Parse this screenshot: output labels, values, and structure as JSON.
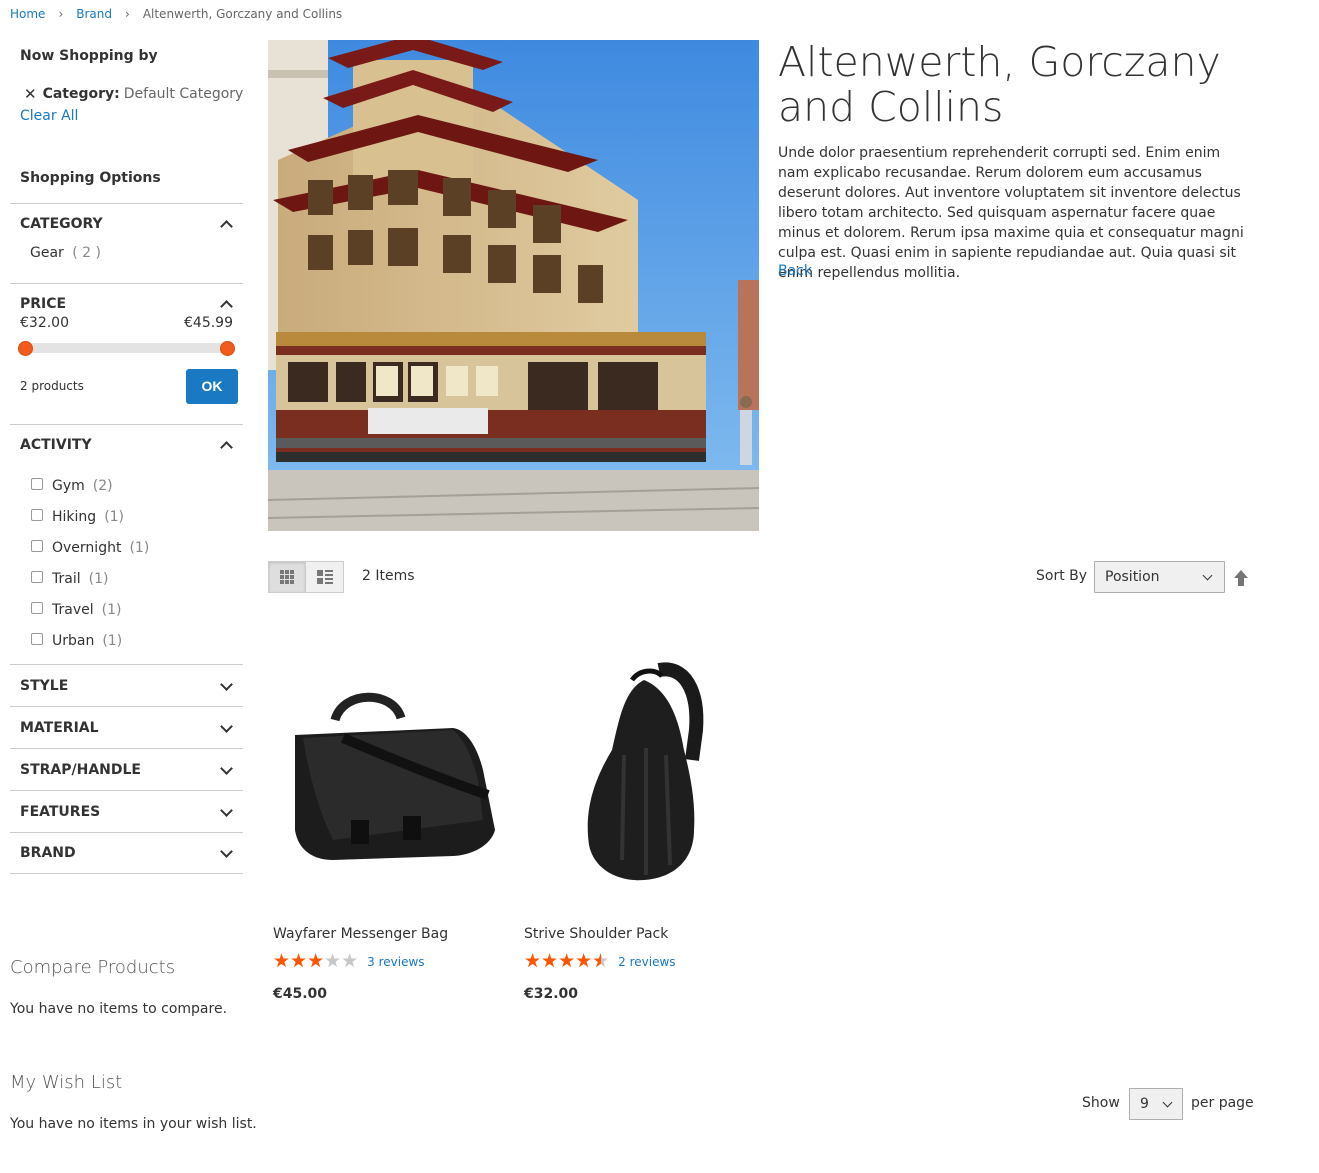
{
  "breadcrumb": {
    "home": "Home",
    "brand": "Brand",
    "current": "Altenwerth, Gorczany and Collins"
  },
  "sidebar": {
    "now_shopping_title": "Now Shopping by",
    "active_filter": {
      "label": "Category:",
      "value": "Default Category"
    },
    "clear_all": "Clear All",
    "shopping_options_title": "Shopping Options",
    "category": {
      "title": "Category",
      "items": [
        {
          "label": "Gear",
          "count": "( 2 )"
        }
      ]
    },
    "price": {
      "title": "Price",
      "min": "€32.00",
      "max": "€45.99",
      "range_low": 0,
      "range_high": 1,
      "product_count": "2 products",
      "ok": "OK"
    },
    "activity": {
      "title": "Activity",
      "items": [
        {
          "label": "Gym",
          "count": "(2)"
        },
        {
          "label": "Hiking",
          "count": "(1)"
        },
        {
          "label": "Overnight",
          "count": "(1)"
        },
        {
          "label": "Trail",
          "count": "(1)"
        },
        {
          "label": "Travel",
          "count": "(1)"
        },
        {
          "label": "Urban",
          "count": "(1)"
        }
      ]
    },
    "collapsed_sections": [
      "Style",
      "Material",
      "Strap/Handle",
      "Features",
      "Brand"
    ],
    "compare_title": "Compare Products",
    "compare_empty": "You have no items to compare.",
    "wishlist_title": "My Wish List",
    "wishlist_empty": "You have no items in your wish list."
  },
  "brand": {
    "title": "Altenwerth, Gorczany and Collins",
    "description": "Unde dolor praesentium reprehenderit corrupti sed. Enim enim nam explicabo recusandae. Rerum dolorem eum accusamus deserunt dolores. Aut inventore voluptatem sit inventore delectus libero totam architecto. Sed quisquam aspernatur facere quae minus et dolorem. Rerum ipsa maxime quia et consequatur magni culpa est. Quasi enim in sapiente repudiandae aut. Quia quasi sit enim repellendus mollitia.",
    "back": "Back"
  },
  "toolbar": {
    "items_count": "2 Items",
    "sort_label": "Sort By",
    "sort_value": "Position",
    "show_label": "Show",
    "limit_value": "9",
    "per_page": "per page"
  },
  "products": [
    {
      "name": "Wayfarer Messenger Bag",
      "rating_fraction": 0.6,
      "reviews": "3 reviews",
      "price": "€45.00"
    },
    {
      "name": "Strive Shoulder Pack",
      "rating_fraction": 0.9,
      "reviews": "2 reviews",
      "price": "€32.00"
    }
  ],
  "colors": {
    "link": "#1979c3",
    "accent": "#f25b1c",
    "star": "#ff5501"
  }
}
